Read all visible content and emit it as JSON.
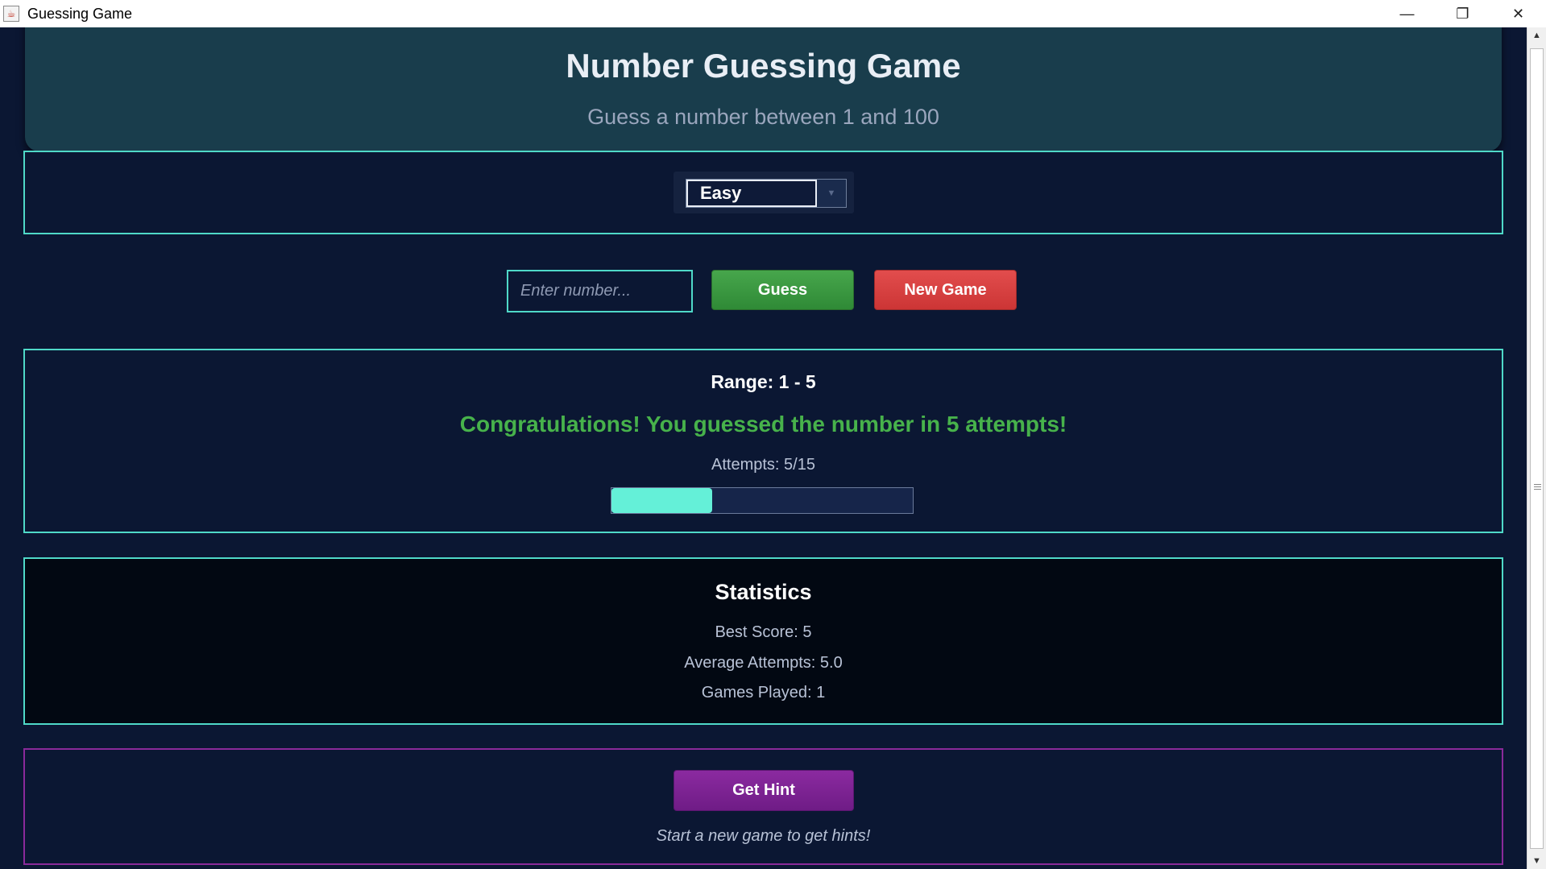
{
  "window": {
    "title": "Guessing Game",
    "app_icon": "java-cup-icon",
    "controls": {
      "minimize": "—",
      "restore": "❐",
      "close": "✕"
    }
  },
  "header": {
    "title": "Number Guessing Game",
    "subtitle": "Guess a number between 1 and 100"
  },
  "difficulty": {
    "selected": "Easy",
    "arrow_icon": "chevron-down-icon"
  },
  "guess_input": {
    "placeholder": "Enter number...",
    "value": ""
  },
  "buttons": {
    "guess_label": "Guess",
    "new_game_label": "New Game",
    "hint_label": "Get Hint"
  },
  "result": {
    "range_text": "Range: 1 - 5",
    "message": "Congratulations! You guessed the number in 5 attempts!",
    "attempts_text": "Attempts: 5/15",
    "progress_fraction": 0.333
  },
  "statistics": {
    "title": "Statistics",
    "best_score": "Best Score: 5",
    "average_attempts": "Average Attempts: 5.0",
    "games_played": "Games Played: 1"
  },
  "hint": {
    "message": "Start a new game to get hints!"
  },
  "colors": {
    "background": "#0b1733",
    "accent_teal": "#4fd9c8",
    "success_green": "#47b24b",
    "danger_red": "#cc3535",
    "hint_purple": "#8b2aa0",
    "progress_fill": "#64f0d8"
  }
}
